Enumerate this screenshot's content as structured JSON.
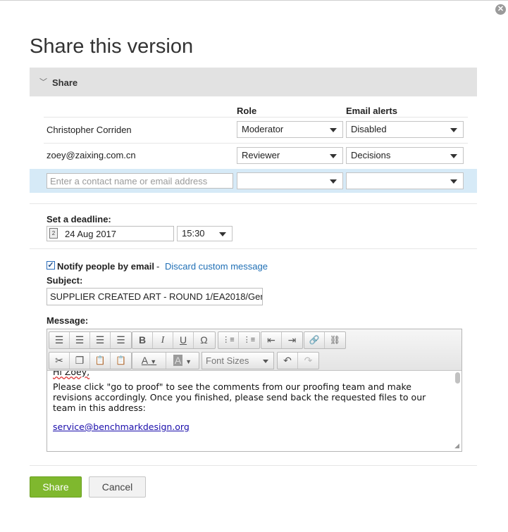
{
  "window": {
    "title": "Share this version",
    "close_icon": "close-icon"
  },
  "share_section": {
    "label": "Share"
  },
  "table": {
    "columns": {
      "role": "Role",
      "email_alerts": "Email alerts"
    },
    "rows": [
      {
        "name": "Christopher Corriden",
        "role": "Moderator",
        "alerts": "Disabled"
      },
      {
        "name": "zoey@zaixing.com.cn",
        "role": "Reviewer",
        "alerts": "Decisions"
      }
    ],
    "new_contact": {
      "placeholder": "Enter a contact name or email address",
      "role": "",
      "alerts": ""
    }
  },
  "deadline": {
    "label": "Set a deadline:",
    "date": "24 Aug 2017",
    "time": "15:30",
    "calendar_icon_text": "2"
  },
  "notify": {
    "checked": true,
    "label": "Notify people by email",
    "separator": "-",
    "discard_link": "Discard custom message"
  },
  "subject": {
    "label": "Subject:",
    "value": "SUPPLIER CREATED ART - ROUND 1/EA2018/Ger"
  },
  "message": {
    "label": "Message:",
    "font_sizes": "Font Sizes",
    "greeting": "Hi Zoey,",
    "body": "Please click \"go to proof\" to see the comments from our proofing team and make revisions accordingly. Once you finished, please send back the requested files to our team in this address:",
    "email_link": "service@benchmarkdesign.org"
  },
  "toolbar_glyphs": {
    "align_left": "☰",
    "align_center": "☰",
    "align_right": "☰",
    "justify": "☰",
    "bold": "B",
    "italic": "I",
    "underline": "U",
    "omega": "Ω",
    "bullets": "⋮≡",
    "numbered": "⋮≡",
    "outdent": "⇤",
    "indent": "⇥",
    "link": "🔗",
    "unlink": "⛓",
    "cut": "✂",
    "copy": "❐",
    "paste": "📋",
    "paste_text": "📋",
    "text_color": "A",
    "bg_color": "A",
    "undo": "↶",
    "redo": "↷"
  },
  "buttons": {
    "share": "Share",
    "cancel": "Cancel"
  },
  "colors": {
    "primary_button": "#7fb82e",
    "link": "#1f6fb5",
    "highlight_row": "#d6eaf7",
    "section_bar": "#e2e2e2"
  }
}
